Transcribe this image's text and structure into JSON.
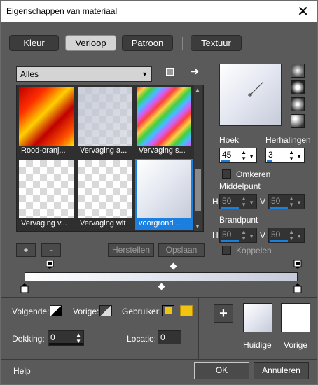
{
  "window": {
    "title": "Eigenschappen van materiaal",
    "close": "✕"
  },
  "tabs": [
    {
      "label": "Kleur",
      "active": false
    },
    {
      "label": "Verloop",
      "active": true
    },
    {
      "label": "Patroon",
      "active": false
    },
    {
      "label": "Textuur",
      "active": false
    }
  ],
  "category": {
    "value": "Alles"
  },
  "gallery": {
    "items": [
      {
        "label": "Rood-oranj..."
      },
      {
        "label": "Vervaging a..."
      },
      {
        "label": "Vervaging s..."
      },
      {
        "label": "Vervaging v..."
      },
      {
        "label": "Vervaging wit"
      },
      {
        "label": "voorgrond ...",
        "selected": true
      }
    ]
  },
  "buttons": {
    "add": "+",
    "remove": "-",
    "restore": "Herstellen",
    "save": "Opslaan"
  },
  "angle": {
    "label": "Hoek",
    "value": "45"
  },
  "repeats": {
    "label": "Herhalingen",
    "value": "3"
  },
  "invert": {
    "label": "Omkeren"
  },
  "center": {
    "label": "Middelpunt",
    "h_label": "H",
    "h_value": "50",
    "v_label": "V",
    "v_value": "50"
  },
  "focus": {
    "label": "Brandpunt",
    "h_label": "H",
    "h_value": "50",
    "v_label": "V",
    "v_value": "50"
  },
  "link": {
    "label": "Koppelen"
  },
  "stops": {
    "next_label": "Volgende:",
    "prev_label": "Vorige:",
    "user_label": "Gebruiker:",
    "opacity_label": "Dekking:",
    "opacity_value": "0",
    "location_label": "Locatie:",
    "location_value": "0",
    "user_colors": [
      "#f1c40f",
      "#f1c40f"
    ]
  },
  "swatches": {
    "current_label": "Huidige",
    "previous_label": "Vorige",
    "add": "+"
  },
  "footer": {
    "help": "Help",
    "ok": "OK",
    "cancel": "Annuleren"
  },
  "colors": {
    "accent": "#1b7fe0",
    "bg": "#5a5a5a"
  }
}
